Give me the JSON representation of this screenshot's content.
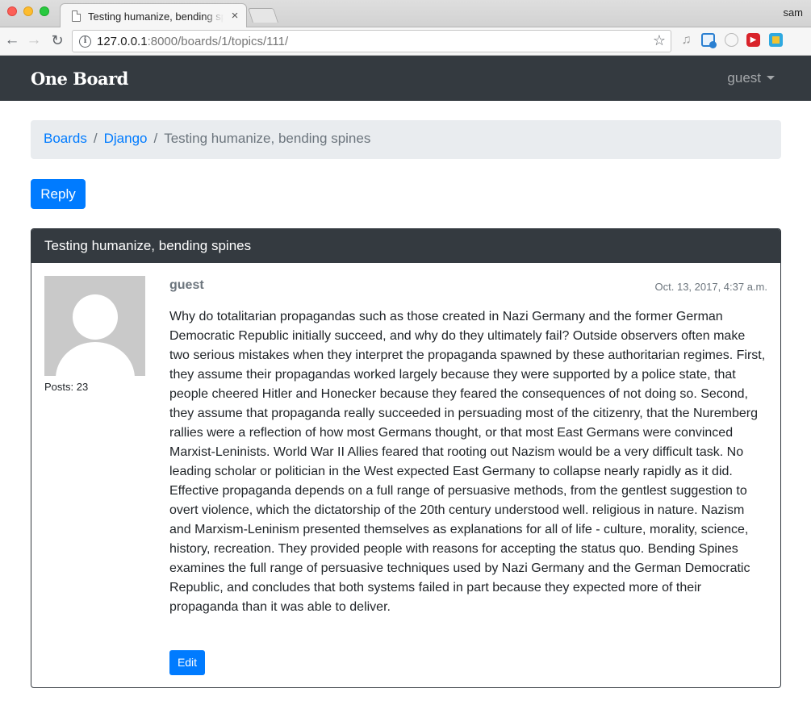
{
  "browser": {
    "tab_title": "Testing humanize, bending spines",
    "tab_close": "×",
    "profile_name": "sam",
    "url_host": "127.0.0.1",
    "url_path": ":8000/boards/1/topics/111/"
  },
  "navbar": {
    "brand": "One Board",
    "user": "guest"
  },
  "breadcrumb": {
    "items": [
      "Boards",
      "Django"
    ],
    "separator": "/",
    "active": "Testing humanize, bending spines"
  },
  "actions": {
    "reply_label": "Reply"
  },
  "post": {
    "header_title": "Testing humanize, bending spines",
    "author": "guest",
    "posts_count": "Posts: 23",
    "date": "Oct. 13, 2017, 4:37 a.m.",
    "message": "Why do totalitarian propagandas such as those created in Nazi Germany and the former German Democratic Republic initially succeed, and why do they ultimately fail? Outside observers often make two serious mistakes when they interpret the propaganda spawned by these authoritarian regimes. First, they assume their propagandas worked largely because they were supported by a police state, that people cheered Hitler and Honecker because they feared the consequences of not doing so. Second, they assume that propaganda really succeeded in persuading most of the citizenry, that the Nuremberg rallies were a reflection of how most Germans thought, or that most East Germans were convinced Marxist-Leninists. World War II Allies feared that rooting out Nazism would be a very difficult task. No leading scholar or politician in the West expected East Germany to collapse nearly rapidly as it did. Effective propaganda depends on a full range of persuasive methods, from the gentlest suggestion to overt violence, which the dictatorship of the 20th century understood well. religious in nature. Nazism and Marxism-Leninism presented themselves as explanations for all of life - culture, morality, science, history, recreation. They provided people with reasons for accepting the status quo. Bending Spines examines the full range of persuasive techniques used by Nazi Germany and the German Democratic Republic, and concludes that both systems failed in part because they expected more of their propaganda than it was able to deliver.",
    "edit_label": "Edit"
  },
  "colors": {
    "primary": "#007bff",
    "dark": "#343a40",
    "muted": "#6c757d",
    "breadcrumb_bg": "#e9ecef"
  }
}
